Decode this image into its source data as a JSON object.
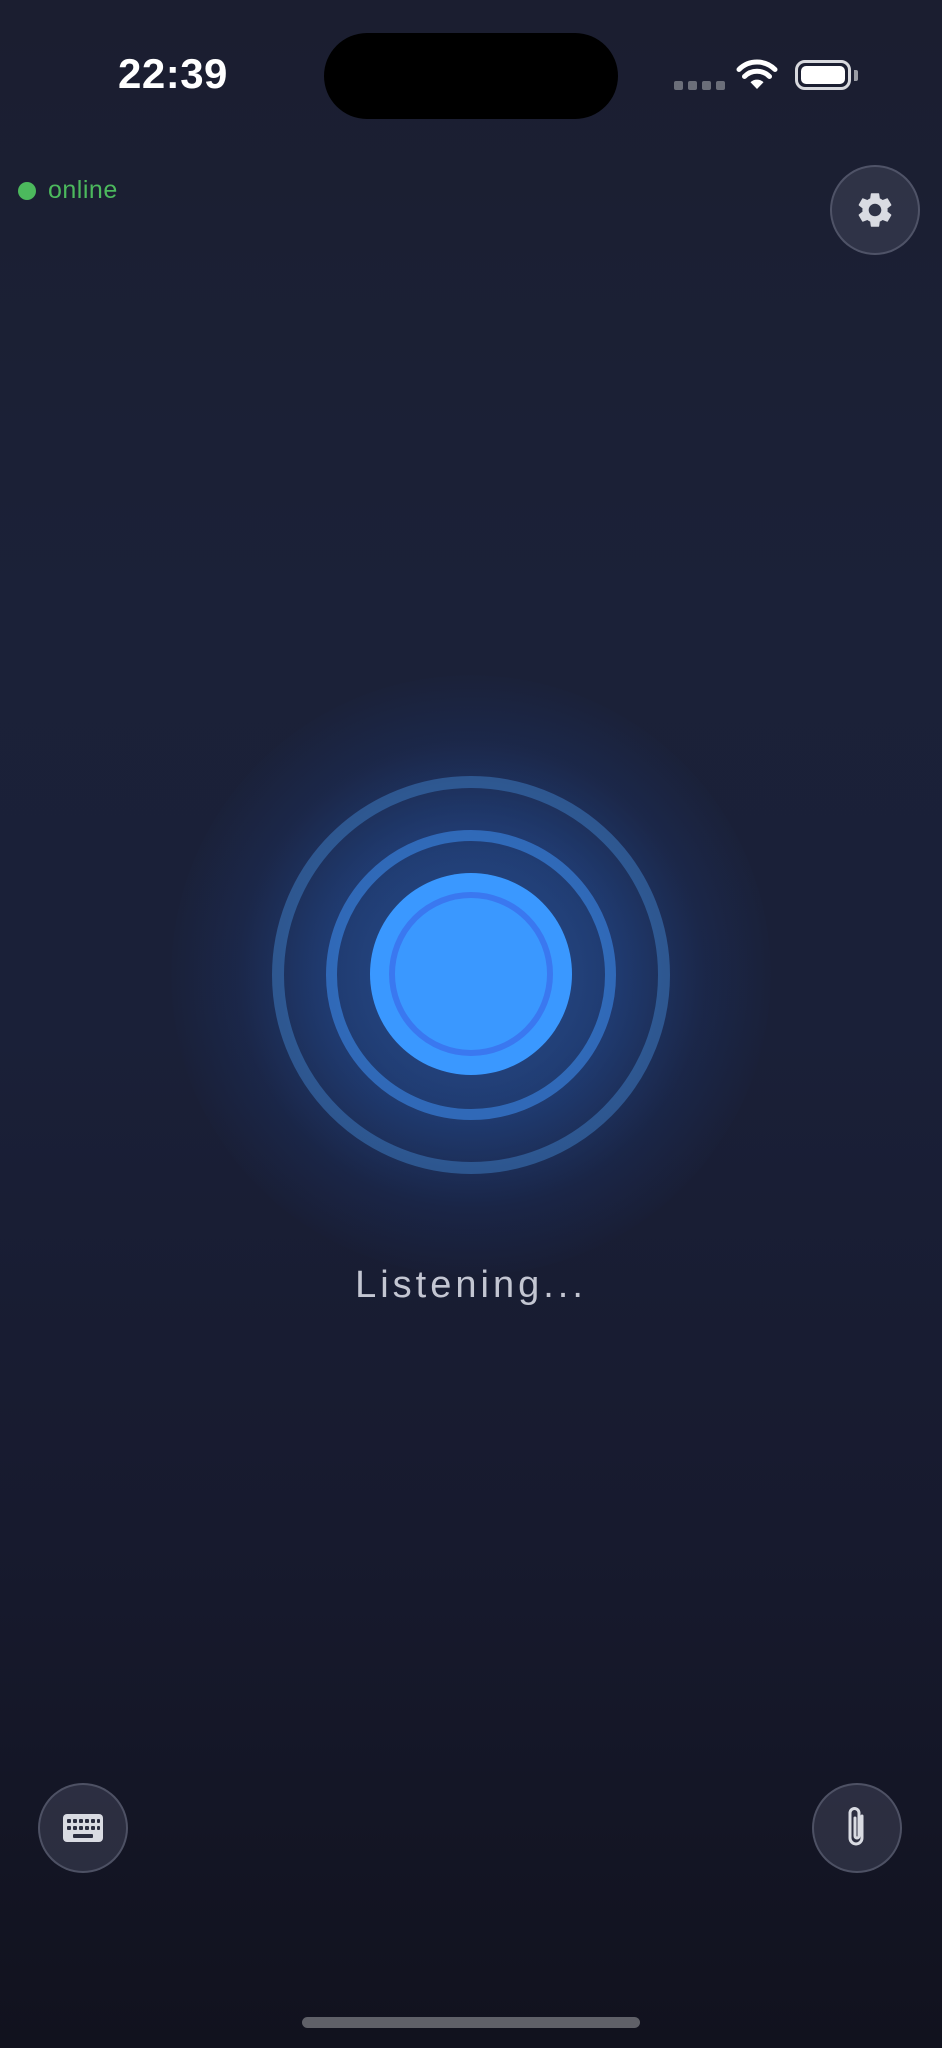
{
  "status_bar": {
    "time": "22:39",
    "signal_icon": "cellular-signal-icon",
    "wifi_icon": "wifi-icon",
    "battery_icon": "battery-icon"
  },
  "connection": {
    "label": "online",
    "color": "#4cb95d"
  },
  "header": {
    "settings_icon": "gear-icon"
  },
  "voice": {
    "status_text": "Listening...",
    "accent_color": "#3a98ff"
  },
  "bottom_bar": {
    "keyboard_icon": "keyboard-icon",
    "attach_icon": "paperclip-icon"
  }
}
